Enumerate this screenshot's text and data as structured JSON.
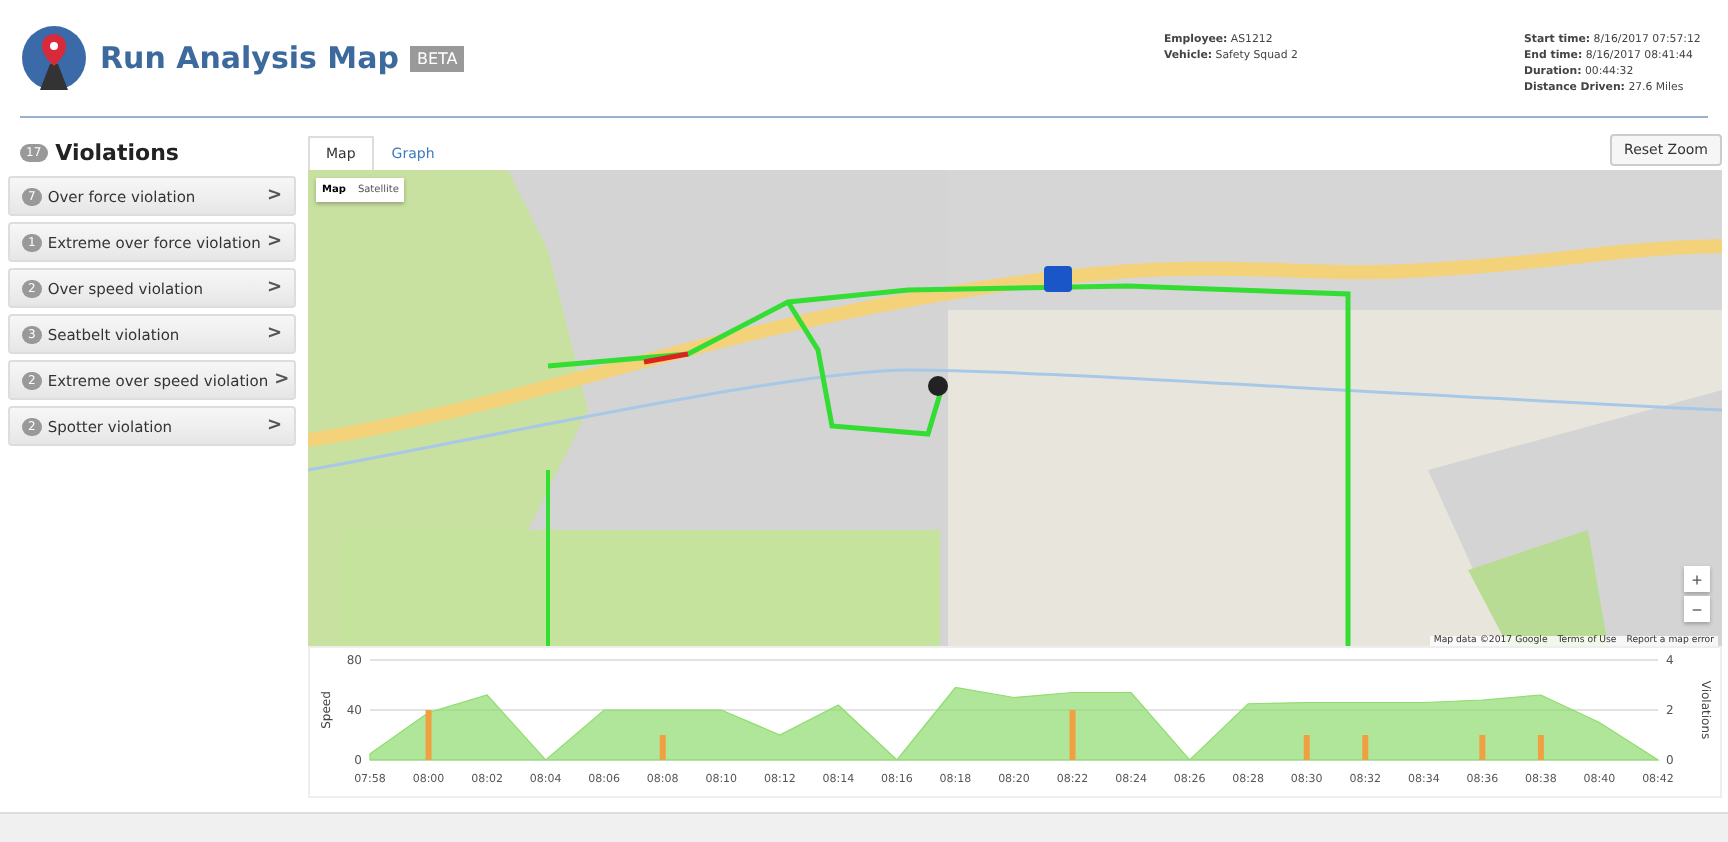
{
  "header": {
    "title": "Run Analysis Map",
    "badge": "BETA",
    "info_left": [
      {
        "label": "Employee:",
        "value": "AS1212"
      },
      {
        "label": "Vehicle:",
        "value": "Safety Squad 2"
      }
    ],
    "info_right": [
      {
        "label": "Start time:",
        "value": "8/16/2017 07:57:12"
      },
      {
        "label": "End time:",
        "value": "8/16/2017 08:41:44"
      },
      {
        "label": "Duration:",
        "value": "00:44:32"
      },
      {
        "label": "Distance Driven:",
        "value": "27.6 Miles"
      }
    ]
  },
  "violations": {
    "count": "17",
    "title": "Violations",
    "items": [
      {
        "count": "7",
        "label": "Over force violation",
        "chevron": ">"
      },
      {
        "count": "1",
        "label": "Extreme over force violation",
        "chevron": ">"
      },
      {
        "count": "2",
        "label": "Over speed violation",
        "chevron": ">"
      },
      {
        "count": "3",
        "label": "Seatbelt violation",
        "chevron": ">"
      },
      {
        "count": "2",
        "label": "Extreme over speed violation",
        "chevron": ">"
      },
      {
        "count": "2",
        "label": "Spotter violation",
        "chevron": ">"
      }
    ]
  },
  "tabs": [
    {
      "label": "Map",
      "selected": true
    },
    {
      "label": "Graph",
      "selected": false
    }
  ],
  "reset_button": "Reset Zoom",
  "map": {
    "kind": "picture",
    "types": [
      {
        "label": "Map",
        "selected": true
      },
      {
        "label": "Satellite",
        "selected": false
      }
    ],
    "zoom_in": "+",
    "zoom_out": "−",
    "attribution": [
      "Map data ©2017 Google",
      "Terms of Use",
      "Report a map error"
    ]
  },
  "chart": {
    "chart_data": {
      "type": "area",
      "categories": [
        "07:58",
        "08:00",
        "08:02",
        "08:04",
        "08:06",
        "08:08",
        "08:10",
        "08:12",
        "08:14",
        "08:16",
        "08:18",
        "08:20",
        "08:22",
        "08:24",
        "08:26",
        "08:28",
        "08:30",
        "08:32",
        "08:34",
        "08:36",
        "08:38",
        "08:40",
        "08:42"
      ],
      "series": [
        {
          "name": "Speed",
          "color": "#8fdc6e",
          "values": [
            5,
            38,
            52,
            0,
            40,
            40,
            40,
            20,
            44,
            0,
            58,
            50,
            54,
            54,
            0,
            45,
            46,
            46,
            46,
            48,
            52,
            30,
            0
          ]
        }
      ],
      "ylim": [
        0,
        80
      ],
      "yticks": [
        0,
        40,
        80
      ]
    },
    "violations_chart": {
      "chart_data": {
        "type": "bar",
        "series": [
          {
            "name": "Violations",
            "color": "#f0a040",
            "values": [
              null,
              2,
              null,
              null,
              null,
              1,
              null,
              null,
              null,
              null,
              null,
              null,
              2,
              null,
              null,
              null,
              1,
              1,
              null,
              1,
              1,
              null,
              null
            ]
          }
        ],
        "ylim": [
          0,
          4
        ],
        "yticks": [
          0,
          2,
          4
        ]
      }
    }
  }
}
